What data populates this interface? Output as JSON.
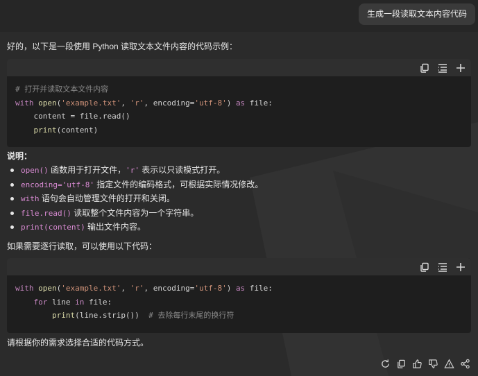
{
  "user_message": "生成一段读取文本内容代码",
  "reply": {
    "intro": "好的，以下是一段使用 Python 读取文本文件内容的代码示例：",
    "code1": {
      "lines": [
        "# 打开并读取文本文件内容",
        "with open('example.txt', 'r', encoding='utf-8') as file:",
        "    content = file.read()",
        "    print(content)"
      ]
    },
    "explain_title": "说明：",
    "bullets": [
      {
        "code": "open()",
        "text": " 函数用于打开文件，",
        "code2": "'r'",
        "text2": " 表示以只读模式打开。"
      },
      {
        "code": "encoding='utf-8'",
        "text": " 指定文件的编码格式，可根据实际情况修改。",
        "code2": "",
        "text2": ""
      },
      {
        "code": "with",
        "text": " 语句会自动管理文件的打开和关闭。",
        "code2": "",
        "text2": ""
      },
      {
        "code": "file.read()",
        "text": " 读取整个文件内容为一个字符串。",
        "code2": "",
        "text2": ""
      },
      {
        "code": "print(content)",
        "text": " 输出文件内容。",
        "code2": "",
        "text2": ""
      }
    ],
    "line_read_intro": "如果需要逐行读取，可以使用以下代码：",
    "code2": {
      "lines": [
        "with open('example.txt', 'r', encoding='utf-8') as file:",
        "    for line in file:",
        "        print(line.strip())  # 去除每行末尾的换行符"
      ]
    },
    "outro": "请根据你的需求选择合适的代码方式。"
  },
  "code_toolbar_icons": [
    "copy-icon",
    "wrap-icon",
    "expand-icon"
  ],
  "action_icons": [
    "regenerate-icon",
    "copy-icon",
    "thumbs-up-icon",
    "thumbs-down-icon",
    "report-icon",
    "share-icon"
  ],
  "colors": {
    "background": "#2b2b2b",
    "code_bg": "#1e1e1e",
    "keyword": "#c586c0",
    "string": "#ce9178",
    "comment": "#8a8a8a",
    "function": "#dcdcaa"
  }
}
